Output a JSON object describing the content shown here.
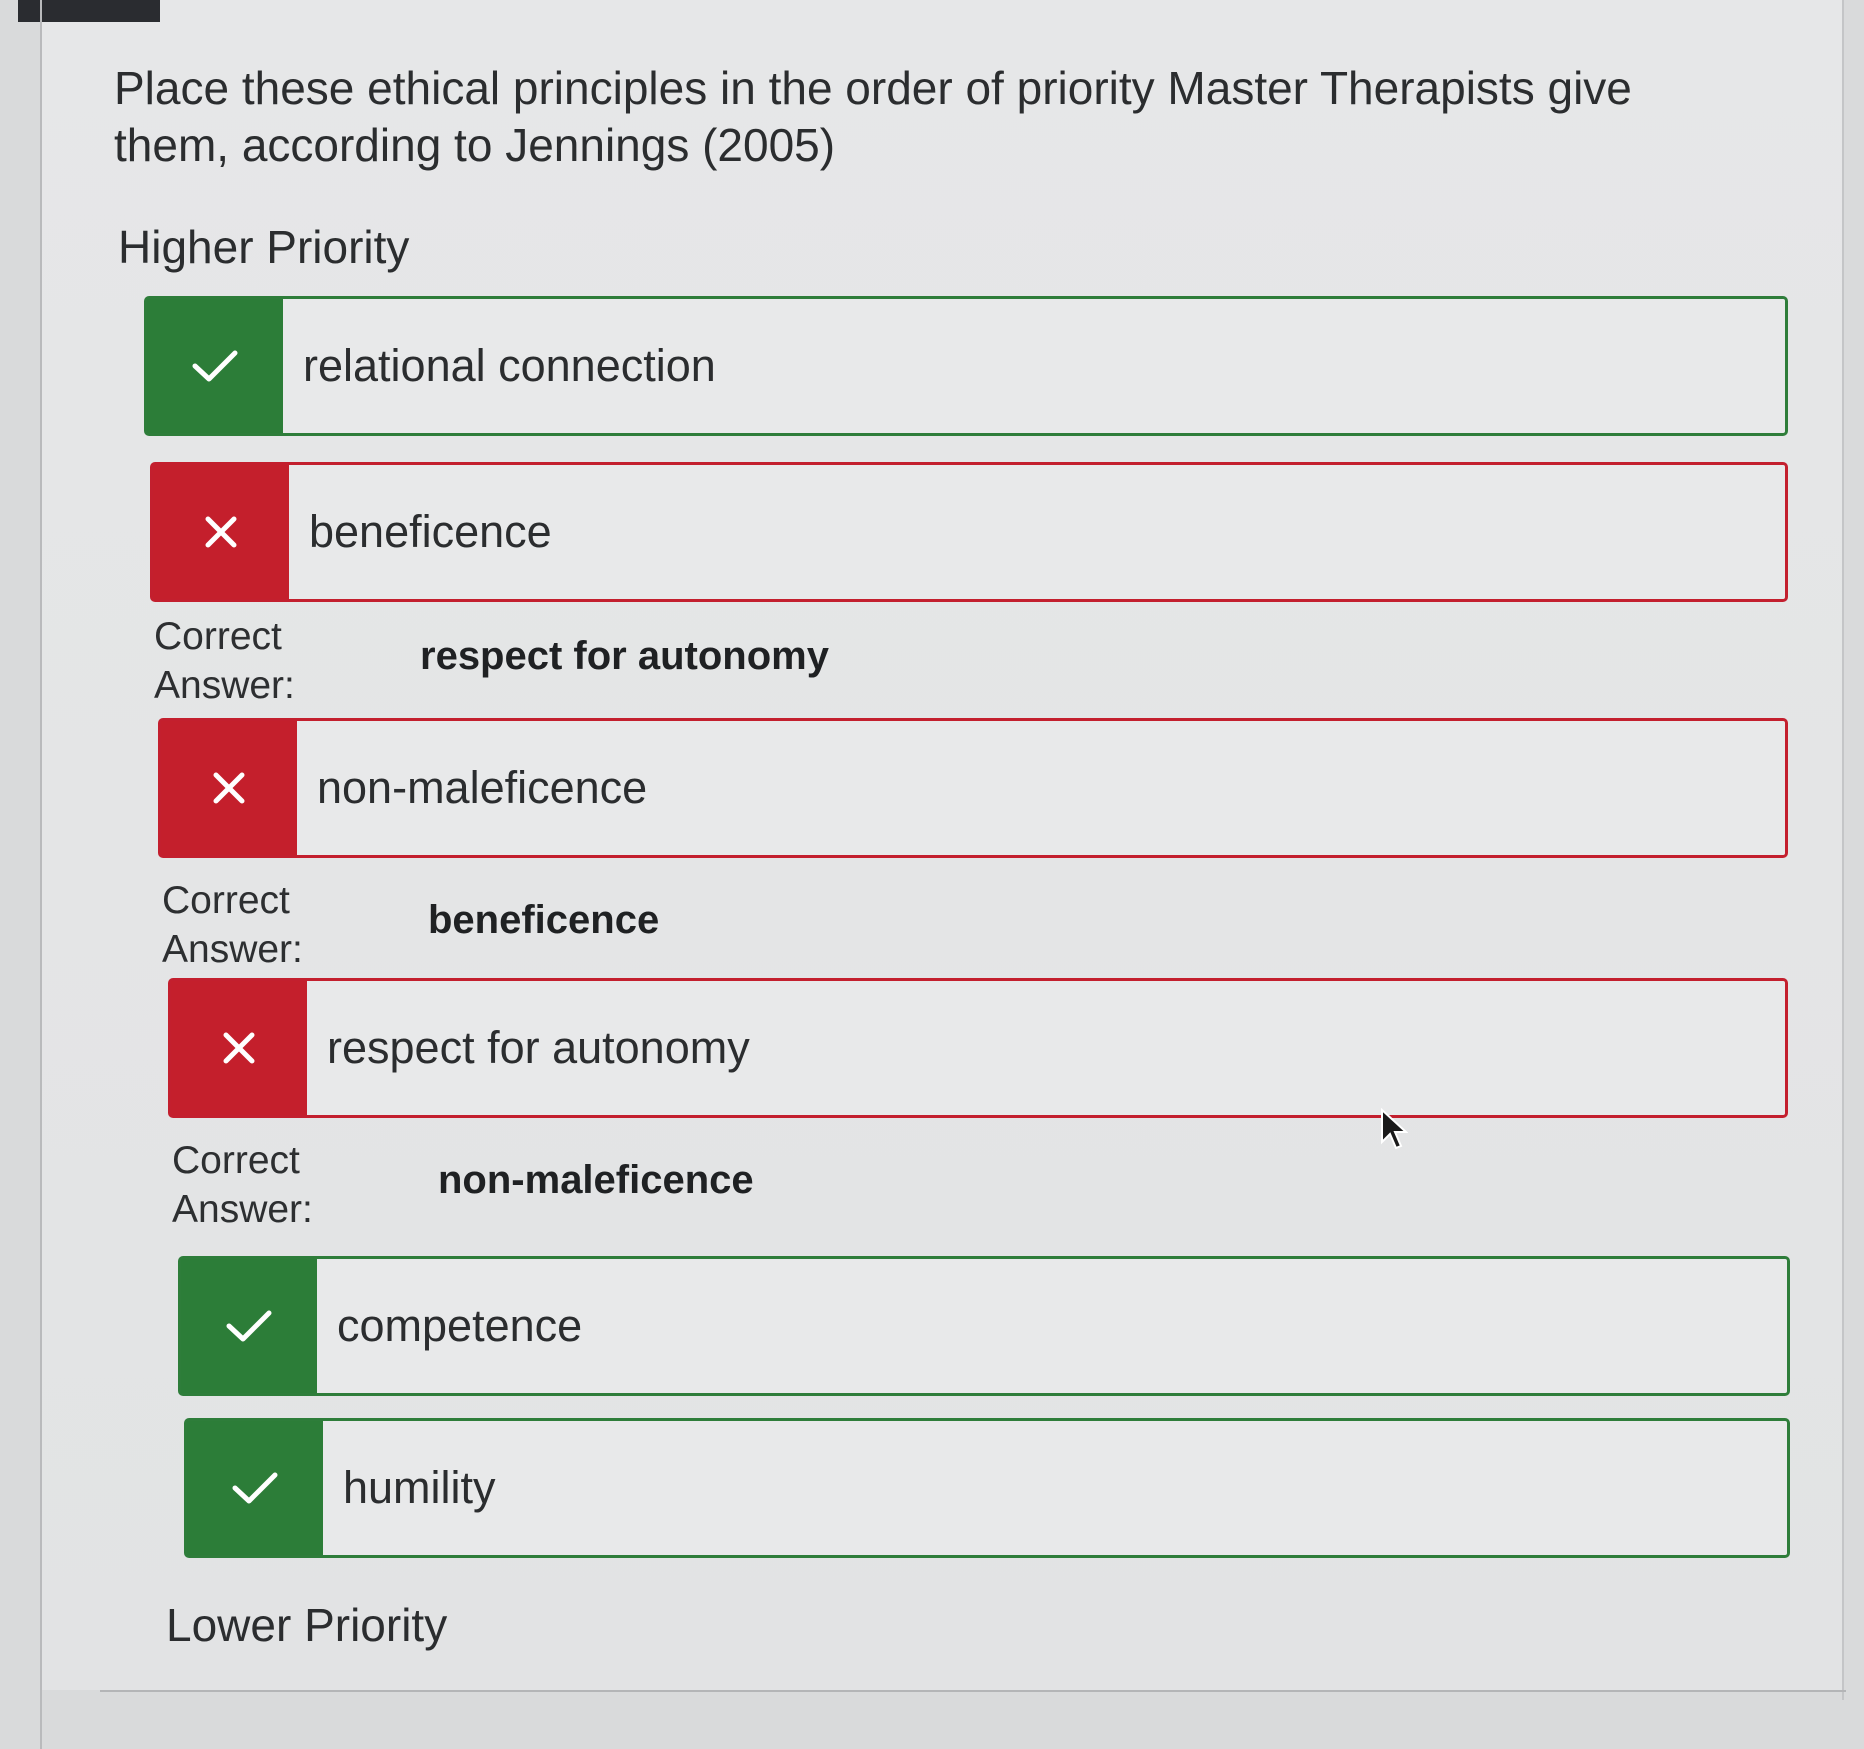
{
  "question": {
    "text": "Place these ethical principles in the order of priority Master Therapists give them, according to Jennings (2005)"
  },
  "labels": {
    "higher": "Higher Priority",
    "lower": "Lower Priority",
    "correct_answer": "Correct Answer:"
  },
  "colors": {
    "correct": "#2c7d38",
    "incorrect": "#c41f2c"
  },
  "items": [
    {
      "text": "relational connection",
      "status": "correct",
      "icon": "check-icon"
    },
    {
      "text": "beneficence",
      "status": "incorrect",
      "icon": "close-icon",
      "correct_answer": "respect for autonomy"
    },
    {
      "text": "non-maleficence",
      "status": "incorrect",
      "icon": "close-icon",
      "correct_answer": "beneficence"
    },
    {
      "text": "respect for autonomy",
      "status": "incorrect",
      "icon": "close-icon",
      "correct_answer": "non-maleficence"
    },
    {
      "text": "competence",
      "status": "correct",
      "icon": "check-icon"
    },
    {
      "text": "humility",
      "status": "correct",
      "icon": "check-icon"
    }
  ]
}
